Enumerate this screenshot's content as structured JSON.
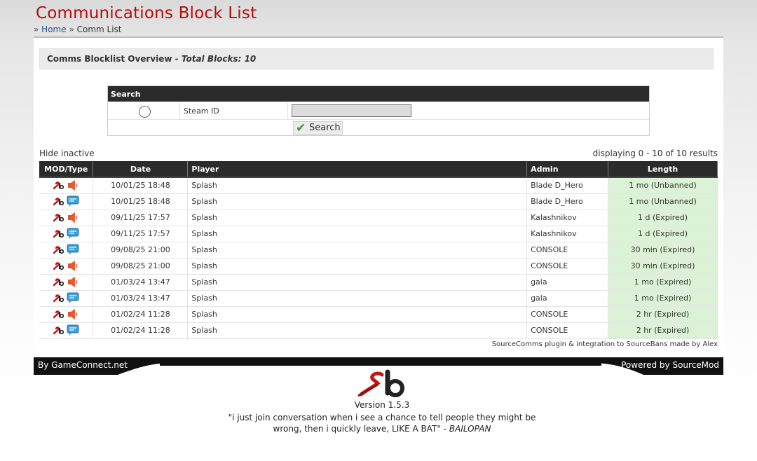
{
  "header": {
    "title": "Communications Block List",
    "breadcrumb": {
      "sep": "»",
      "home": "Home",
      "current": "Comm List"
    }
  },
  "overview": {
    "label": "Comms Blocklist Overview - ",
    "total": "Total Blocks: 10"
  },
  "search": {
    "heading": "Search",
    "field_label": "Steam ID",
    "input_value": "",
    "button_label": "Search",
    "button_icon": "checkmark-icon"
  },
  "list": {
    "hide_inactive": "Hide inactive",
    "results": "displaying 0 - 10 of 10 results",
    "columns": [
      "MOD/Type",
      "Date",
      "Player",
      "Admin",
      "Length"
    ],
    "rows": [
      {
        "type": "voice",
        "date": "10/01/25 18:48",
        "player": "Splash",
        "admin": "Blade D_Hero",
        "length": "1 mo (Unbanned)"
      },
      {
        "type": "chat",
        "date": "10/01/25 18:48",
        "player": "Splash",
        "admin": "Blade D_Hero",
        "length": "1 mo (Unbanned)"
      },
      {
        "type": "voice",
        "date": "09/11/25 17:57",
        "player": "Splash",
        "admin": "Kalashnikov",
        "length": "1 d (Expired)"
      },
      {
        "type": "chat",
        "date": "09/11/25 17:57",
        "player": "Splash",
        "admin": "Kalashnikov",
        "length": "1 d (Expired)"
      },
      {
        "type": "chat",
        "date": "09/08/25 21:00",
        "player": "Splash",
        "admin": "CONSOLE",
        "length": "30 min (Expired)"
      },
      {
        "type": "voice",
        "date": "09/08/25 21:00",
        "player": "Splash",
        "admin": "CONSOLE",
        "length": "30 min (Expired)"
      },
      {
        "type": "voice",
        "date": "01/03/24 13:47",
        "player": "Splash",
        "admin": "gala",
        "length": "1 mo (Expired)"
      },
      {
        "type": "chat",
        "date": "01/03/24 13:47",
        "player": "Splash",
        "admin": "gala",
        "length": "1 mo (Expired)"
      },
      {
        "type": "voice",
        "date": "01/02/24 11:28",
        "player": "Splash",
        "admin": "CONSOLE",
        "length": "2 hr (Expired)"
      },
      {
        "type": "chat",
        "date": "01/02/24 11:28",
        "player": "Splash",
        "admin": "CONSOLE",
        "length": "2 hr (Expired)"
      }
    ],
    "credit": "SourceComms plugin & integration to SourceBans made by Alex"
  },
  "footer": {
    "left": "By GameConnect.net",
    "right": "Powered by SourceMod",
    "version": "Version 1.5.3",
    "quote": "\"i just join conversation when i see a chance to tell people they might be wrong, then i quickly leave, LIKE A BAT\"",
    "quote_sep": " - ",
    "quote_author": "BAILOPAN"
  },
  "colors": {
    "title": "#b40d0d",
    "length_cell": "#dcf2d6",
    "header_bg": "#2b2b2b"
  }
}
